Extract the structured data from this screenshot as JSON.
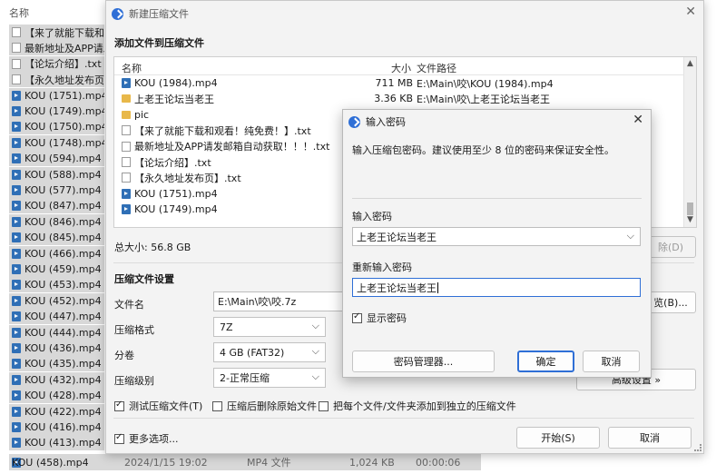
{
  "explorer": {
    "header_name": "名称",
    "rows": [
      {
        "label": "【来了就能下载和观",
        "icon": "txt"
      },
      {
        "label": "最新地址及APP请发",
        "icon": "txt"
      },
      {
        "label": "【论坛介绍】.txt",
        "icon": "txt"
      },
      {
        "label": "【永久地址发布页】",
        "icon": "txt"
      },
      {
        "label": "KOU (1751).mp4",
        "icon": "mp4"
      },
      {
        "label": "KOU (1749).mp4",
        "icon": "mp4"
      },
      {
        "label": "KOU (1750).mp4",
        "icon": "mp4"
      },
      {
        "label": "KOU (1748).mp4",
        "icon": "mp4"
      },
      {
        "label": "KOU (594).mp4",
        "icon": "mp4"
      },
      {
        "label": "KOU (588).mp4",
        "icon": "mp4"
      },
      {
        "label": "KOU (577).mp4",
        "icon": "mp4"
      },
      {
        "label": "KOU (847).mp4",
        "icon": "mp4"
      },
      {
        "label": "KOU (846).mp4",
        "icon": "mp4"
      },
      {
        "label": "KOU (845).mp4",
        "icon": "mp4"
      },
      {
        "label": "KOU (466).mp4",
        "icon": "mp4"
      },
      {
        "label": "KOU (459).mp4",
        "icon": "mp4"
      },
      {
        "label": "KOU (453).mp4",
        "icon": "mp4"
      },
      {
        "label": "KOU (452).mp4",
        "icon": "mp4"
      },
      {
        "label": "KOU (447).mp4",
        "icon": "mp4"
      },
      {
        "label": "KOU (444).mp4",
        "icon": "mp4"
      },
      {
        "label": "KOU (436).mp4",
        "icon": "mp4"
      },
      {
        "label": "KOU (435).mp4",
        "icon": "mp4"
      },
      {
        "label": "KOU (432).mp4",
        "icon": "mp4"
      },
      {
        "label": "KOU (428).mp4",
        "icon": "mp4"
      },
      {
        "label": "KOU (422).mp4",
        "icon": "mp4"
      },
      {
        "label": "KOU (416).mp4",
        "icon": "mp4"
      },
      {
        "label": "KOU (413).mp4",
        "icon": "mp4"
      }
    ],
    "last_row": {
      "name": "KOU (458).mp4",
      "date": "2024/1/15 19:02",
      "type": "MP4 文件",
      "size": "1,024 KB",
      "duration": "00:00:06"
    }
  },
  "main_dialog": {
    "title": "新建压缩文件",
    "add_section": "添加文件到压缩文件",
    "columns": {
      "name": "名称",
      "size": "大小",
      "path": "文件路径"
    },
    "files": [
      {
        "name": "KOU (1984).mp4",
        "size": "711 MB",
        "path": "E:\\Main\\咬\\KOU (1984).mp4",
        "icon": "mp4"
      },
      {
        "name": "上老王论坛当老王",
        "size": "3.36 KB",
        "path": "E:\\Main\\咬\\上老王论坛当老王",
        "icon": "folder"
      },
      {
        "name": "pic",
        "size": "",
        "path": "",
        "icon": "folder"
      },
      {
        "name": "【来了就能下载和观看！纯免费！】.txt",
        "size": "",
        "path": "",
        "icon": "txt"
      },
      {
        "name": "最新地址及APP请发邮箱自动获取！！！.txt",
        "size": "",
        "path": "",
        "icon": "txt"
      },
      {
        "name": "【论坛介绍】.txt",
        "size": "",
        "path": "",
        "icon": "txt"
      },
      {
        "name": "【永久地址发布页】.txt",
        "size": "",
        "path": "",
        "icon": "txt"
      },
      {
        "name": "KOU (1751).mp4",
        "size": "",
        "path": "",
        "icon": "mp4"
      },
      {
        "name": "KOU (1749).mp4",
        "size": "",
        "path": "",
        "icon": "mp4"
      }
    ],
    "total_size": "总大小: 56.8 GB",
    "delete_label": "除(D)",
    "settings_section": "压缩文件设置",
    "filename_label": "文件名",
    "filename_value": "E:\\Main\\咬\\咬.7z",
    "browse_label": "览(B)...",
    "format_label": "压缩格式",
    "format_value": "7Z",
    "split_label": "分卷",
    "split_value": "4 GB (FAT32)",
    "level_label": "压缩级别",
    "level_value": "2-正常压缩",
    "advanced_label": "高级设置 »",
    "chk_test": "测试压缩文件(T)",
    "chk_delete": "压缩后删除原始文件",
    "chk_separate": "把每个文件/文件夹添加到独立的压缩文件",
    "more_options": "更多选项...",
    "start_label": "开始(S)",
    "cancel_label": "取消",
    "accent": "#2f6fd6"
  },
  "password_dialog": {
    "title": "输入密码",
    "description": "输入压缩包密码。建议使用至少 8 位的密码来保证安全性。",
    "enter_label": "输入密码",
    "enter_value": "上老王论坛当老王",
    "reenter_label": "重新输入密码",
    "reenter_value": "上老王论坛当老王",
    "show_password": "显示密码",
    "manager_label": "密码管理器...",
    "ok_label": "确定",
    "cancel_label": "取消"
  }
}
